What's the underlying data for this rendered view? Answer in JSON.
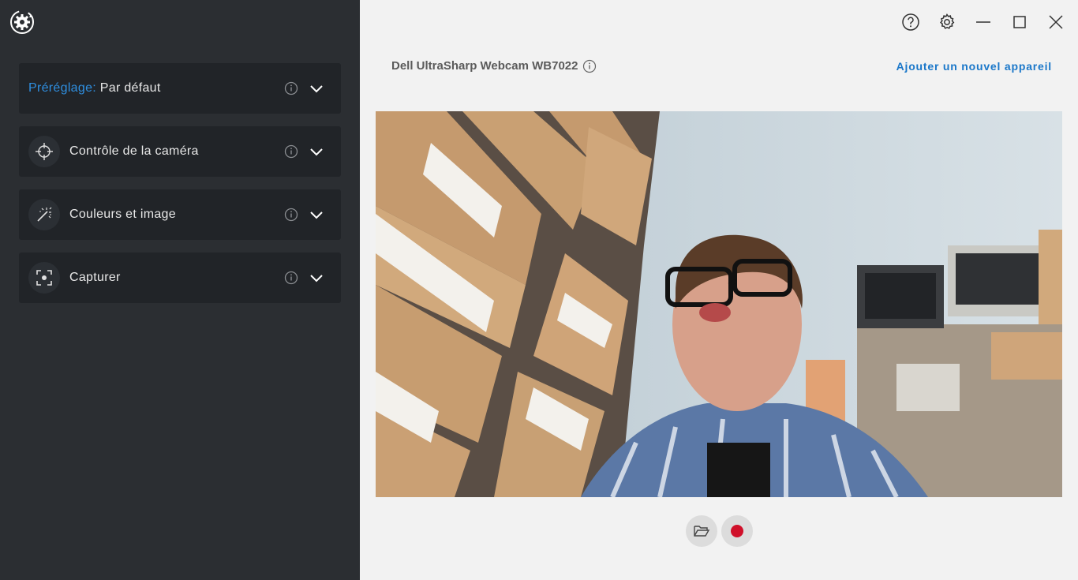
{
  "sidebar": {
    "preset": {
      "key": "Préréglage:",
      "value": "Par défaut"
    },
    "panels": [
      {
        "label": "Contrôle de la caméra",
        "icon": "crosshair-icon"
      },
      {
        "label": "Couleurs et image",
        "icon": "magic-wand-icon"
      },
      {
        "label": "Capturer",
        "icon": "capture-icon"
      }
    ]
  },
  "header": {
    "device_name": "Dell UltraSharp Webcam WB7022",
    "add_device": "Ajouter un nouvel appareil"
  },
  "controls": {
    "open_folder": "folder-open-icon",
    "record": "record-icon"
  },
  "colors": {
    "sidebar_bg": "#2b2e32",
    "panel_bg": "#212428",
    "accent_blue": "#1a77c9",
    "preset_blue": "#2f8fe0",
    "record_red": "#d0102a"
  }
}
